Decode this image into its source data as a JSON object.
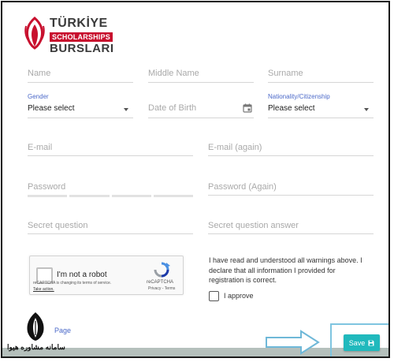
{
  "logo": {
    "title_top": "TÜRKİYE",
    "title_banner": "SCHOLARSHIPS",
    "title_bottom": "BURSLARI",
    "accent_color": "#c8102e"
  },
  "form": {
    "name_placeholder": "Name",
    "middle_name_placeholder": "Middle Name",
    "surname_placeholder": "Surname",
    "gender_label": "Gender",
    "gender_value": "Please select",
    "dob_placeholder": "Date of Birth",
    "nationality_label": "Nationality/Citizenship",
    "nationality_value": "Please select",
    "email_placeholder": "E-mail",
    "email_again_placeholder": "E-mail (again)",
    "password_placeholder": "Password",
    "password_again_placeholder": "Password (Again)",
    "secret_question_placeholder": "Secret question",
    "secret_answer_placeholder": "Secret question answer",
    "label_color": "#4b69c9"
  },
  "captcha": {
    "label": "I'm not a robot",
    "brand": "reCAPTCHA",
    "terms": "Privacy - Terms",
    "notice": "reCAPTCHA is changing its terms of service.",
    "notice_link": "Take action."
  },
  "declaration": {
    "text": "I have read and understood all warnings above. I declare that all information I provided for registration is correct.",
    "approve_label": "I approve"
  },
  "navigation": {
    "previous_page": "Page",
    "save_label": "Save",
    "save_icon": "floppy-disk-icon",
    "save_color": "#20b9bd"
  },
  "watermark": {
    "text": "سامانه مشاوره هیوا"
  }
}
